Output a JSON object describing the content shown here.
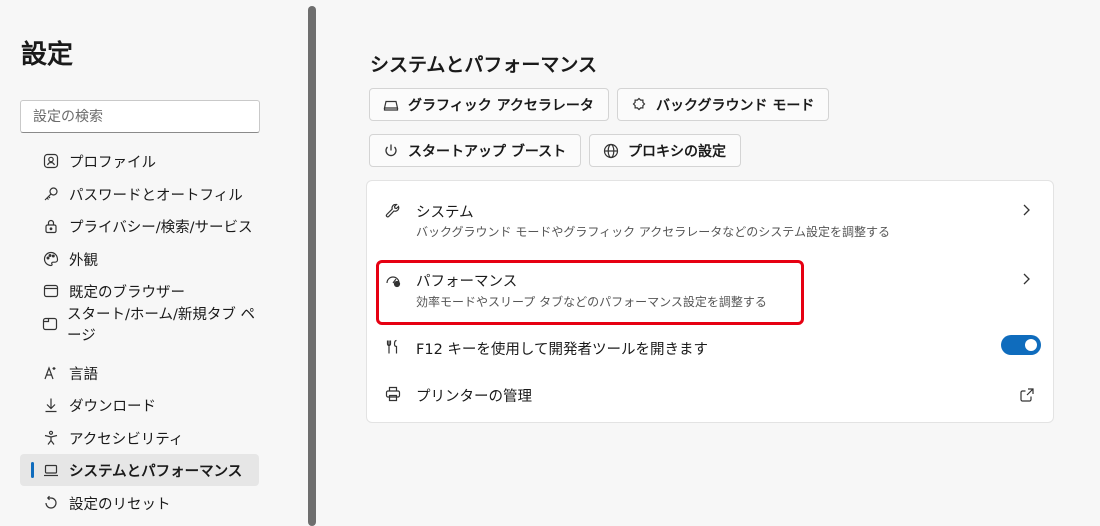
{
  "sidebar": {
    "title": "設定",
    "search_placeholder": "設定の検索",
    "items": [
      {
        "label": "プロファイル",
        "icon": "profile-icon"
      },
      {
        "label": "パスワードとオートフィル",
        "icon": "key-icon"
      },
      {
        "label": "プライバシー/検索/サービス",
        "icon": "lock-icon"
      },
      {
        "label": "外観",
        "icon": "palette-icon"
      },
      {
        "label": "既定のブラウザー",
        "icon": "browser-icon"
      },
      {
        "label": "スタート/ホーム/新規タブ ページ",
        "icon": "home-page-icon"
      },
      {
        "label": "言語",
        "icon": "language-icon"
      },
      {
        "label": "ダウンロード",
        "icon": "download-icon"
      },
      {
        "label": "アクセシビリティ",
        "icon": "accessibility-icon"
      },
      {
        "label": "システムとパフォーマンス",
        "icon": "laptop-icon",
        "active": true
      },
      {
        "label": "設定のリセット",
        "icon": "reset-icon"
      }
    ]
  },
  "main": {
    "title": "システムとパフォーマンス",
    "chips": [
      {
        "label": "グラフィック アクセラレータ",
        "icon": "graphics-icon"
      },
      {
        "label": "バックグラウンド モード",
        "icon": "background-icon"
      },
      {
        "label": "スタートアップ ブースト",
        "icon": "power-icon"
      },
      {
        "label": "プロキシの設定",
        "icon": "globe-icon"
      }
    ],
    "rows": {
      "system": {
        "title": "システム",
        "desc": "バックグラウンド モードやグラフィック アクセラレータなどのシステム設定を調整する"
      },
      "performance": {
        "title": "パフォーマンス",
        "desc": "効率モードやスリープ タブなどのパフォーマンス設定を調整する"
      },
      "devtools": {
        "title": "F12 キーを使用して開発者ツールを開きます",
        "toggle": true
      },
      "printer": {
        "title": "プリンターの管理"
      }
    }
  },
  "colors": {
    "accent": "#0f6cbd",
    "highlight": "#e60012"
  }
}
